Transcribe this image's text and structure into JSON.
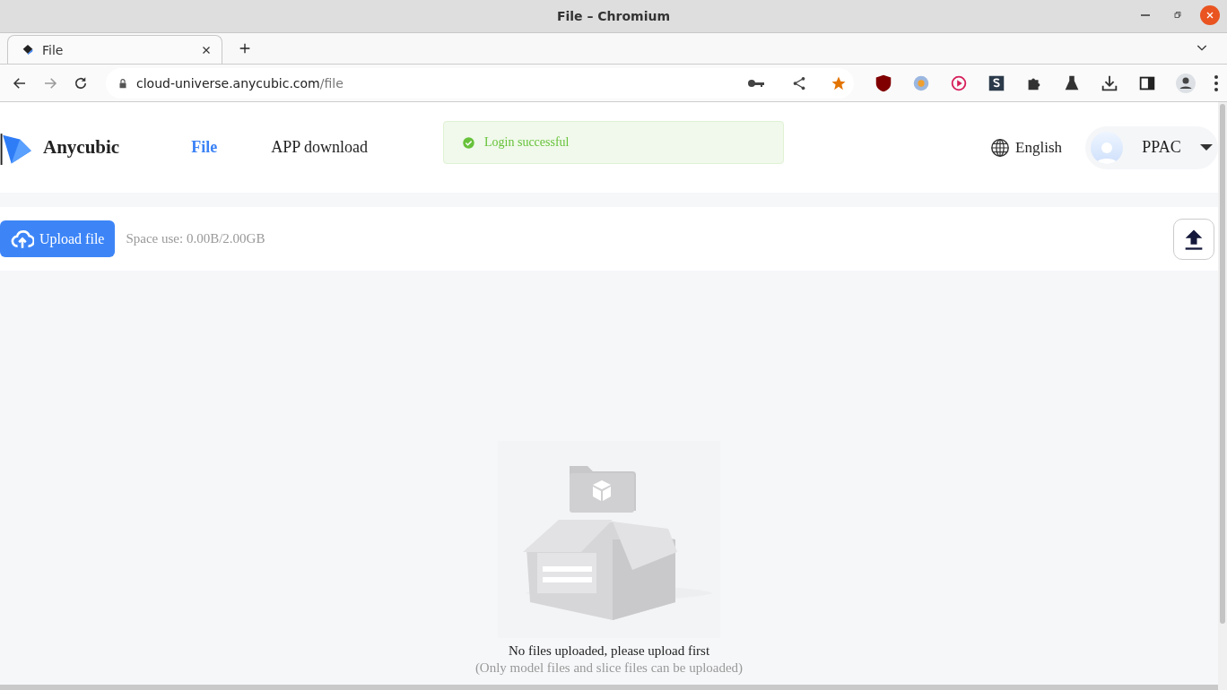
{
  "window": {
    "title": "File – Chromium"
  },
  "tabs": [
    {
      "label": "File",
      "selected": true
    }
  ],
  "address_bar": {
    "host": "cloud-universe.anycubic.com",
    "path": "/file"
  },
  "page": {
    "logo": "Anycubic",
    "nav": [
      {
        "label": "File",
        "selected": true
      },
      {
        "label": "APP download",
        "selected": false
      }
    ],
    "toast": "Login successful",
    "language": "English",
    "user": "PPAC",
    "upload_button": "Upload file",
    "space_use": "Space use: 0.00B/2.00GB",
    "empty_title": "No files uploaded, please upload first",
    "empty_hint": "(Only model files and slice files can be uploaded)"
  }
}
